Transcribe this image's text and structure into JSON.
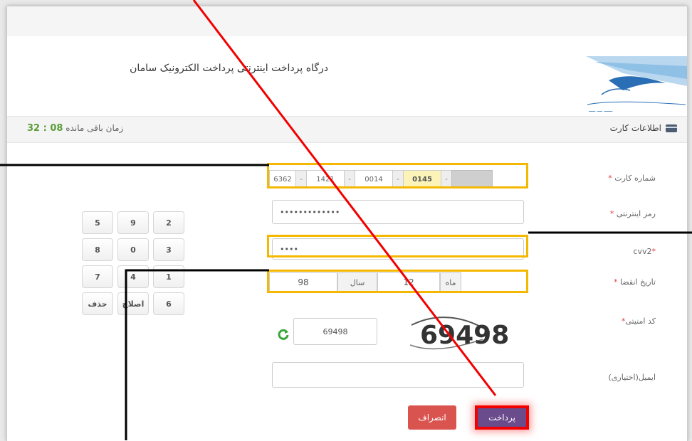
{
  "header": {
    "title": "درگاه پرداخت اینترنتی پرداخت الکترونیک سامان",
    "logo_icon": "sep-logo-icon"
  },
  "info_bar": {
    "card_info_label": "اطلاعات کارت",
    "timer_label": "زمان باقی مانده",
    "timer_value": "32 : 08"
  },
  "form": {
    "card_number": {
      "label": "شماره کارت",
      "segments": [
        "6362",
        "1421",
        "0014",
        "0145",
        ""
      ]
    },
    "internet_password": {
      "label": "رمز اینترنتی",
      "value": "•••••••••••••"
    },
    "cvv2": {
      "label": "cvv2",
      "value": "••••"
    },
    "expiry": {
      "label": "تاریخ انقضا",
      "month_label": "ماه",
      "month_value": "12",
      "year_label": "سال",
      "year_value": "98"
    },
    "captcha": {
      "label": "کد امنیتی",
      "value": "69498",
      "image_text": "69498"
    },
    "email": {
      "label": "ایمیل(اختیاری)",
      "value": ""
    }
  },
  "keypad": {
    "keys": [
      "5",
      "9",
      "2",
      "8",
      "0",
      "3",
      "7",
      "4",
      "1",
      "حذف",
      "اصلاح",
      "6"
    ]
  },
  "buttons": {
    "pay": "پرداخت",
    "cancel": "انصراف"
  },
  "colors": {
    "highlight": "#f5b800",
    "annotation_red": "#f20000",
    "pay_button": "#6a4b8c",
    "cancel_button": "#d9534f",
    "timer_green": "#5a9e3a"
  }
}
